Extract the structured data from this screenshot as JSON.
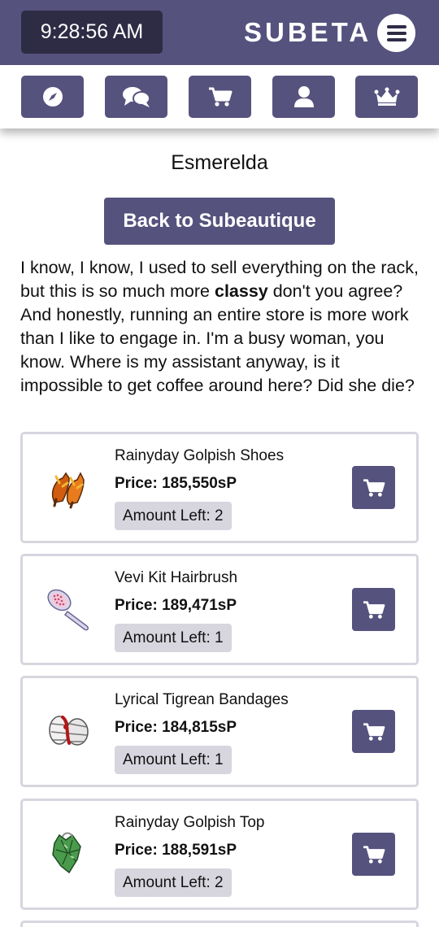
{
  "header": {
    "clock": "9:28:56 AM",
    "brand": "SUBETA",
    "menu_icon": "hamburger-menu-icon"
  },
  "nav": {
    "items": [
      {
        "icon": "compass-icon"
      },
      {
        "icon": "chat-bubbles-icon"
      },
      {
        "icon": "shopping-cart-icon"
      },
      {
        "icon": "user-icon"
      },
      {
        "icon": "crown-icon"
      }
    ]
  },
  "shop": {
    "name": "Esmerelda",
    "back_label": "Back to Subeautique",
    "dialogue_before": "I know, I know, I used to sell everything on the rack, but this is so much more ",
    "dialogue_bold": "classy",
    "dialogue_after": " don't you agree? And honestly, running an entire store is more work than I like to engage in. I'm a busy woman, you know. Where is my assistant anyway, is it impossible to get coffee around here? Did she die?"
  },
  "items": [
    {
      "name": "Rainyday Golpish Shoes",
      "price": "Price: 185,550sP",
      "amount": "Amount Left: 2",
      "icon": "shoes-icon"
    },
    {
      "name": "Vevi Kit Hairbrush",
      "price": "Price: 189,471sP",
      "amount": "Amount Left: 1",
      "icon": "hairbrush-icon"
    },
    {
      "name": "Lyrical Tigrean Bandages",
      "price": "Price: 184,815sP",
      "amount": "Amount Left: 1",
      "icon": "bandages-icon"
    },
    {
      "name": "Rainyday Golpish Top",
      "price": "Price: 188,591sP",
      "amount": "Amount Left: 2",
      "icon": "top-icon"
    }
  ],
  "colors": {
    "primary": "#56527e",
    "clock_bg": "#2e2c45",
    "badge_bg": "#d7d5de"
  }
}
